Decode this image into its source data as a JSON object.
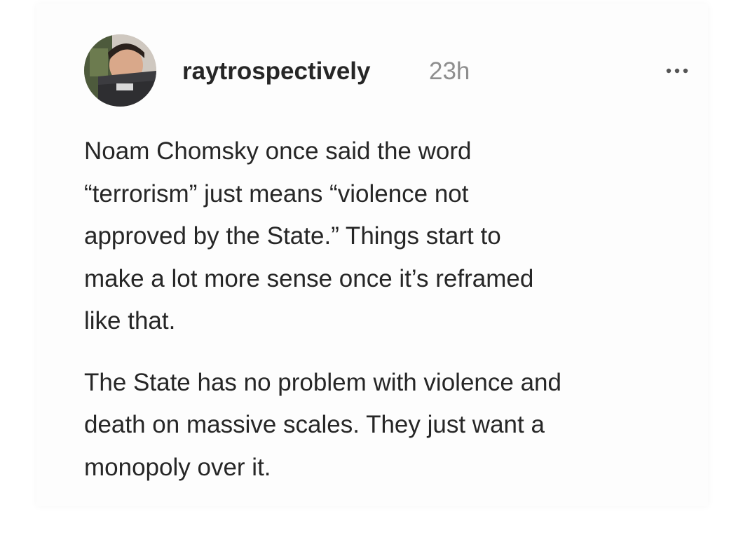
{
  "post": {
    "username": "raytrospectively",
    "timestamp": "23h",
    "avatar_icon": "user-avatar-photo",
    "more_icon": "ellipsis-icon",
    "paragraphs": [
      "Noam Chomsky once said the word\n“terrorism” just means “violence not\napproved by the State.” Things start to\nmake a lot more sense once it’s reframed\nlike that.",
      "The State has no problem with violence and\ndeath on massive scales. They just want a\nmonopoly over it."
    ]
  }
}
